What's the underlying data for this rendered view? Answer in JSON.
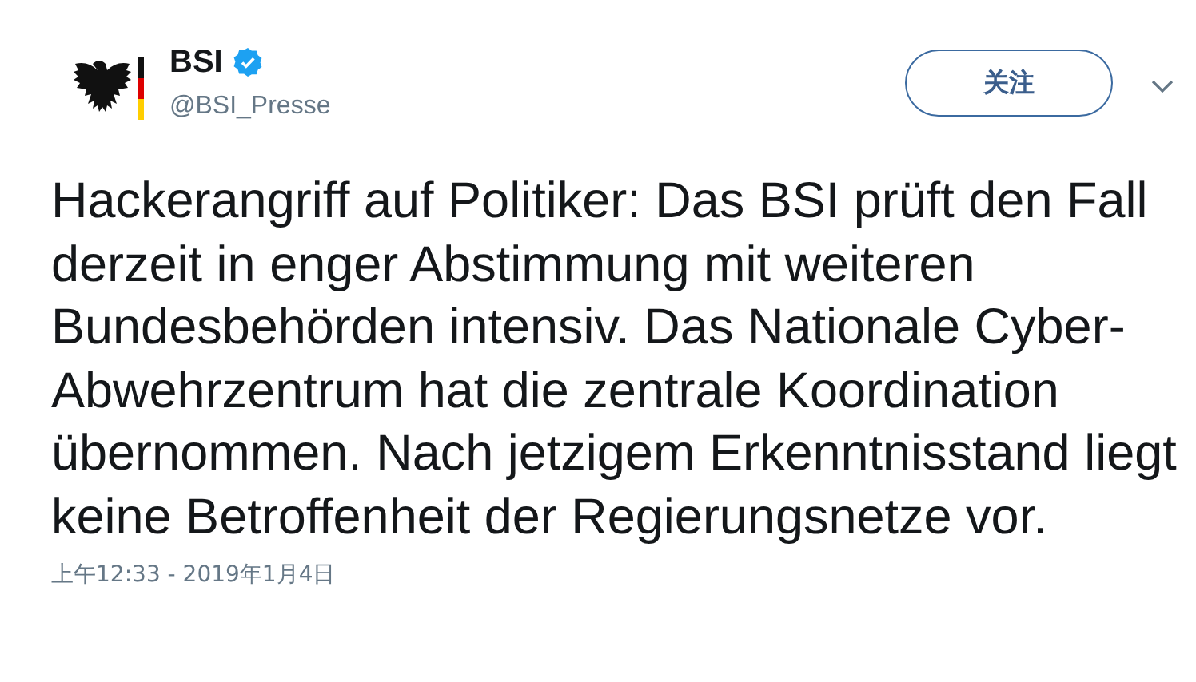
{
  "author": {
    "name": "BSI",
    "verified": true,
    "handle": "@BSI_Presse"
  },
  "follow_button": {
    "label": "关注"
  },
  "tweet": {
    "text": "Hackerangriff auf Politiker: Das BSI prüft den Fall derzeit in enger Abstimmung mit weiteren Bundesbehörden intensiv. Das Nationale Cyber-Abwehrzentrum hat die zentrale Koordination übernommen. Nach jetzigem Erkenntnisstand liegt keine Betroffenheit der Regierungsnetze vor."
  },
  "timestamp": "上午12:33 - 2019年1月4日"
}
